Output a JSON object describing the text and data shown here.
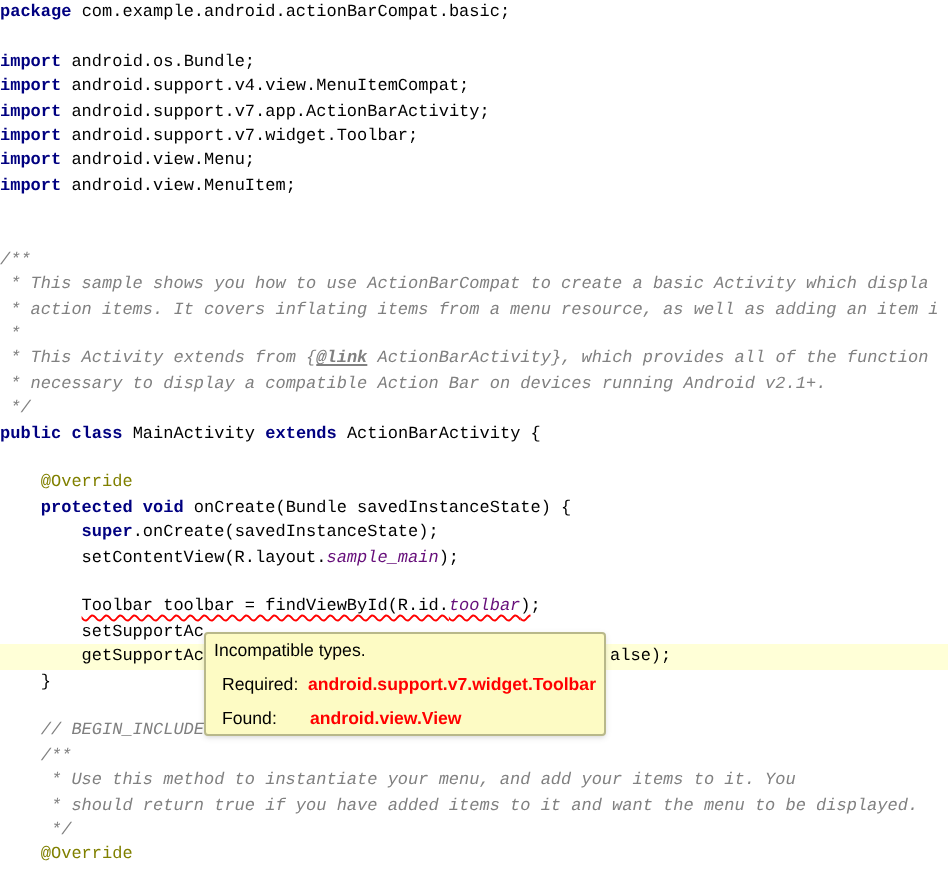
{
  "editor": {
    "lines": [
      {
        "kind": "code",
        "current": false,
        "parts": [
          {
            "kind": "keyword",
            "text": "package"
          },
          {
            "kind": "plain",
            "text": " com.example.android.actionBarCompat.basic;"
          }
        ]
      },
      {
        "kind": "blank",
        "current": false
      },
      {
        "kind": "code",
        "current": false,
        "parts": [
          {
            "kind": "keyword",
            "text": "import"
          },
          {
            "kind": "plain",
            "text": " android.os.Bundle;"
          }
        ]
      },
      {
        "kind": "code",
        "current": false,
        "parts": [
          {
            "kind": "keyword",
            "text": "import"
          },
          {
            "kind": "plain",
            "text": " android.support.v4.view.MenuItemCompat;"
          }
        ]
      },
      {
        "kind": "code",
        "current": false,
        "parts": [
          {
            "kind": "keyword",
            "text": "import"
          },
          {
            "kind": "plain",
            "text": " android.support.v7.app.ActionBarActivity;"
          }
        ]
      },
      {
        "kind": "code",
        "current": false,
        "parts": [
          {
            "kind": "keyword",
            "text": "import"
          },
          {
            "kind": "plain",
            "text": " android.support.v7.widget.Toolbar;"
          }
        ]
      },
      {
        "kind": "code",
        "current": false,
        "parts": [
          {
            "kind": "keyword",
            "text": "import"
          },
          {
            "kind": "plain",
            "text": " android.view.Menu;"
          }
        ]
      },
      {
        "kind": "code",
        "current": false,
        "parts": [
          {
            "kind": "keyword",
            "text": "import"
          },
          {
            "kind": "plain",
            "text": " android.view.MenuItem;"
          }
        ]
      },
      {
        "kind": "blank",
        "current": false
      },
      {
        "kind": "blank",
        "current": false
      },
      {
        "kind": "code",
        "current": false,
        "parts": [
          {
            "kind": "comment",
            "text": "/**"
          }
        ]
      },
      {
        "kind": "code",
        "current": false,
        "parts": [
          {
            "kind": "comment",
            "text": " * This sample shows you how to use ActionBarCompat to create a basic Activity which displa"
          }
        ]
      },
      {
        "kind": "code",
        "current": false,
        "parts": [
          {
            "kind": "comment",
            "text": " * action items. It covers inflating items from a menu resource, as well as adding an item i"
          }
        ]
      },
      {
        "kind": "code",
        "current": false,
        "parts": [
          {
            "kind": "comment",
            "text": " *"
          }
        ]
      },
      {
        "kind": "code",
        "current": false,
        "parts": [
          {
            "kind": "comment",
            "text": " * This Activity extends from {"
          },
          {
            "kind": "doctag",
            "text": "@link"
          },
          {
            "kind": "comment",
            "text": " ActionBarActivity}, which provides all of the function"
          }
        ]
      },
      {
        "kind": "code",
        "current": false,
        "parts": [
          {
            "kind": "comment",
            "text": " * necessary to display a compatible Action Bar on devices running Android v2.1+."
          }
        ]
      },
      {
        "kind": "code",
        "current": false,
        "parts": [
          {
            "kind": "comment",
            "text": " */"
          }
        ]
      },
      {
        "kind": "code",
        "current": false,
        "parts": [
          {
            "kind": "keyword",
            "text": "public class"
          },
          {
            "kind": "plain",
            "text": " MainActivity "
          },
          {
            "kind": "keyword",
            "text": "extends"
          },
          {
            "kind": "plain",
            "text": " ActionBarActivity {"
          }
        ],
        "children": [
          {
            "kind": "blank",
            "current": false
          },
          {
            "kind": "code",
            "current": false,
            "parts": [
              {
                "kind": "annotation",
                "text": "@Override"
              }
            ]
          },
          {
            "kind": "code",
            "current": false,
            "parts": [
              {
                "kind": "keyword",
                "text": "protected void"
              },
              {
                "kind": "plain",
                "text": " onCreate(Bundle savedInstanceState) {"
              }
            ],
            "children": [
              {
                "kind": "code",
                "current": false,
                "parts": [
                  {
                    "kind": "keyword",
                    "text": "super"
                  },
                  {
                    "kind": "plain",
                    "text": ".onCreate(savedInstanceState);"
                  }
                ]
              },
              {
                "kind": "code",
                "current": false,
                "parts": [
                  {
                    "kind": "plain",
                    "text": "setContentView(R.layout."
                  },
                  {
                    "kind": "static",
                    "text": "sample_main"
                  },
                  {
                    "kind": "plain",
                    "text": ");"
                  }
                ]
              },
              {
                "kind": "blank",
                "current": false
              },
              {
                "kind": "code",
                "current": false,
                "parts": [
                  {
                    "kind": "error",
                    "text": "Toolbar toolbar = findViewById(R.id."
                  },
                  {
                    "kind": "error-static",
                    "text": "toolbar"
                  },
                  {
                    "kind": "error",
                    "text": ")"
                  },
                  {
                    "kind": "plain",
                    "text": ";"
                  }
                ]
              },
              {
                "kind": "code",
                "current": false,
                "parts": [
                  {
                    "kind": "plain",
                    "text": "setSupportAc"
                  }
                ]
              },
              {
                "kind": "code",
                "current": true,
                "parts": [
                  {
                    "kind": "plain",
                    "text": "getSupportAc"
                  },
                  {
                    "kind": "after-popup",
                    "text": "alse);"
                  }
                ]
              }
            ]
          },
          {
            "kind": "code",
            "current": false,
            "parts": [
              {
                "kind": "plain",
                "text": "}"
              }
            ]
          },
          {
            "kind": "blank",
            "current": false
          },
          {
            "kind": "code",
            "current": false,
            "parts": [
              {
                "kind": "comment",
                "text": "// BEGIN_INCLUDE"
              }
            ]
          },
          {
            "kind": "code",
            "current": false,
            "parts": [
              {
                "kind": "comment",
                "text": "/**"
              }
            ]
          },
          {
            "kind": "code",
            "current": false,
            "parts": [
              {
                "kind": "comment",
                "text": " * Use this method to instantiate your menu, and add your items to it. You"
              }
            ]
          },
          {
            "kind": "code",
            "current": false,
            "parts": [
              {
                "kind": "comment",
                "text": " * should return true if you have added items to it and want the menu to be displayed."
              }
            ]
          },
          {
            "kind": "code",
            "current": false,
            "parts": [
              {
                "kind": "comment",
                "text": " */"
              }
            ]
          },
          {
            "kind": "code",
            "current": false,
            "parts": [
              {
                "kind": "annotation",
                "text": "@Override"
              }
            ]
          }
        ]
      }
    ]
  },
  "popup": {
    "title": "Incompatible types.",
    "rows": [
      {
        "label": "Required:",
        "value": "android.support.v7.widget.Toolbar"
      },
      {
        "label": "Found:",
        "value": "android.view.View"
      }
    ]
  }
}
